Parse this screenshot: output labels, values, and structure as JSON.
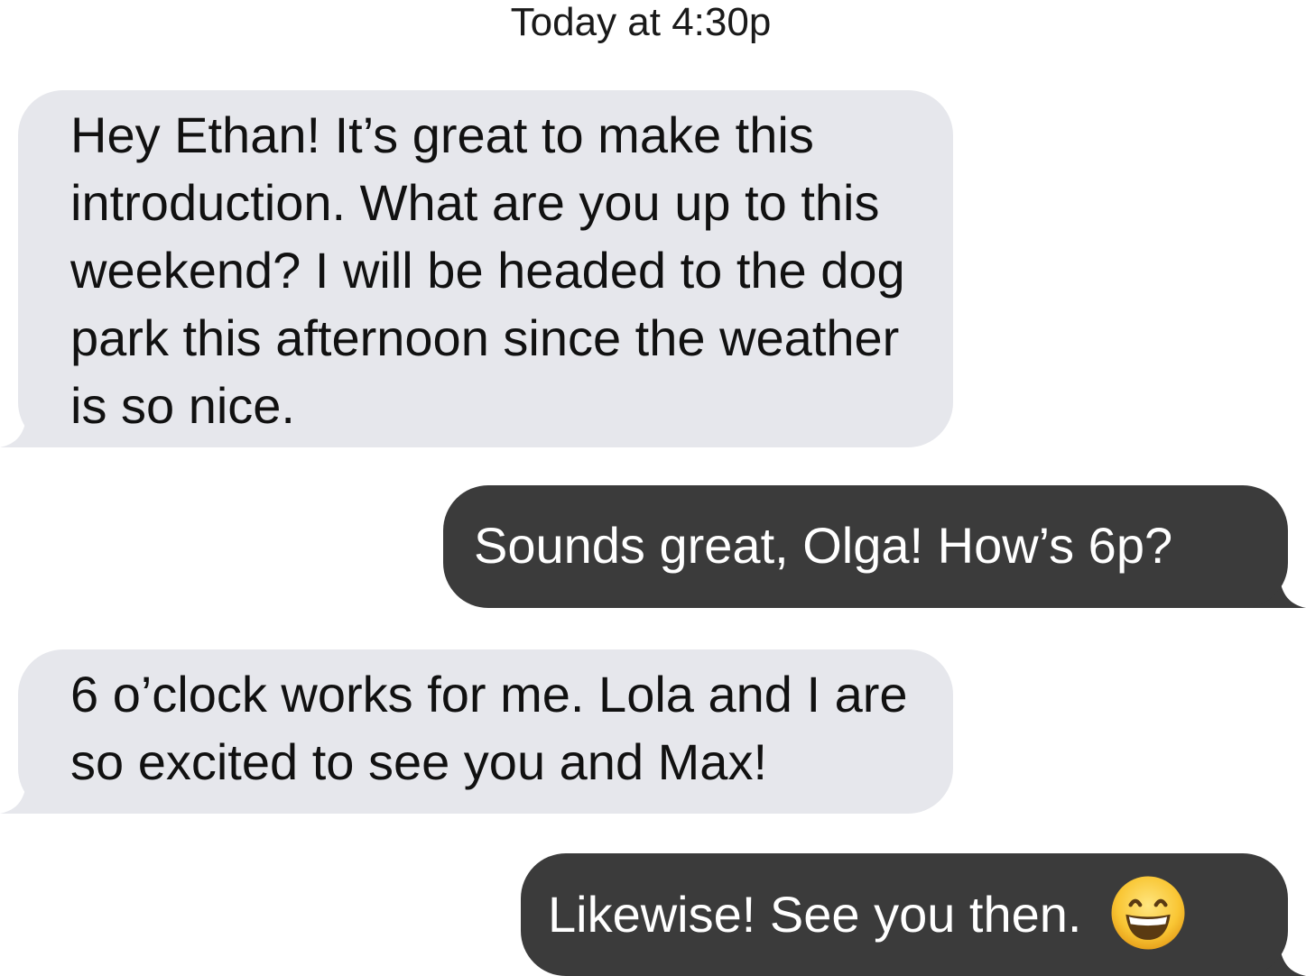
{
  "header": {
    "timestamp": "Today at 4:30p"
  },
  "messages": [
    {
      "direction": "incoming",
      "text": "Hey Ethan! It’s great to make this introduction. What are you up to this weekend? I will be headed to the dog park this afternoon since the weather is so nice."
    },
    {
      "direction": "outgoing",
      "text": "Sounds great, Olga! How’s 6p?"
    },
    {
      "direction": "incoming",
      "text": "6 o’clock works for me. Lola and I are so excited to see you and Max!"
    },
    {
      "direction": "outgoing",
      "text": "Likewise! See you then.",
      "emoji": "grinning-face-icon"
    }
  ],
  "colors": {
    "incoming_bubble": "#e6e7ec",
    "outgoing_bubble": "#3b3b3b",
    "incoming_text": "#111111",
    "outgoing_text": "#ffffff"
  }
}
